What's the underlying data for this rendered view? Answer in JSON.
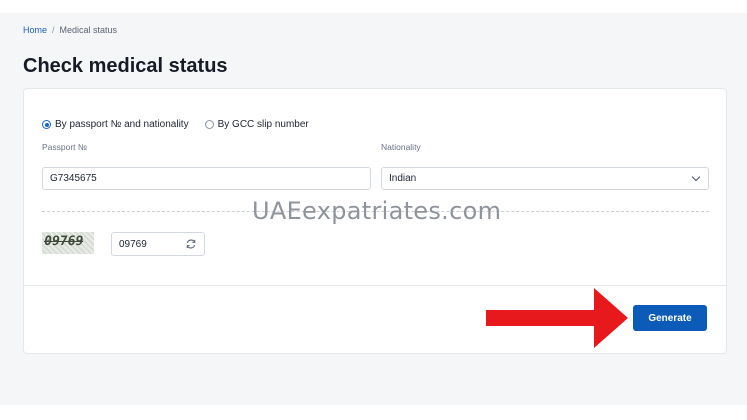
{
  "breadcrumb": {
    "home": "Home",
    "separator": "/",
    "current": "Medical status"
  },
  "page_title": "Check medical status",
  "search_mode": {
    "options": [
      {
        "label": "By passport № and nationality",
        "selected": true
      },
      {
        "label": "By GCC slip number",
        "selected": false
      }
    ]
  },
  "form": {
    "passport_label": "Passport №",
    "passport_value": "G7345675",
    "nationality_label": "Nationality",
    "nationality_value": "Indian"
  },
  "captcha": {
    "image_text": "09769",
    "input_value": "09769",
    "refresh_icon": "refresh-icon"
  },
  "actions": {
    "generate_label": "Generate"
  },
  "watermark": "UAEexpatriates.com",
  "colors": {
    "accent": "#0d5bb8",
    "arrow": "#e8191c",
    "background": "#f5f6f8"
  }
}
